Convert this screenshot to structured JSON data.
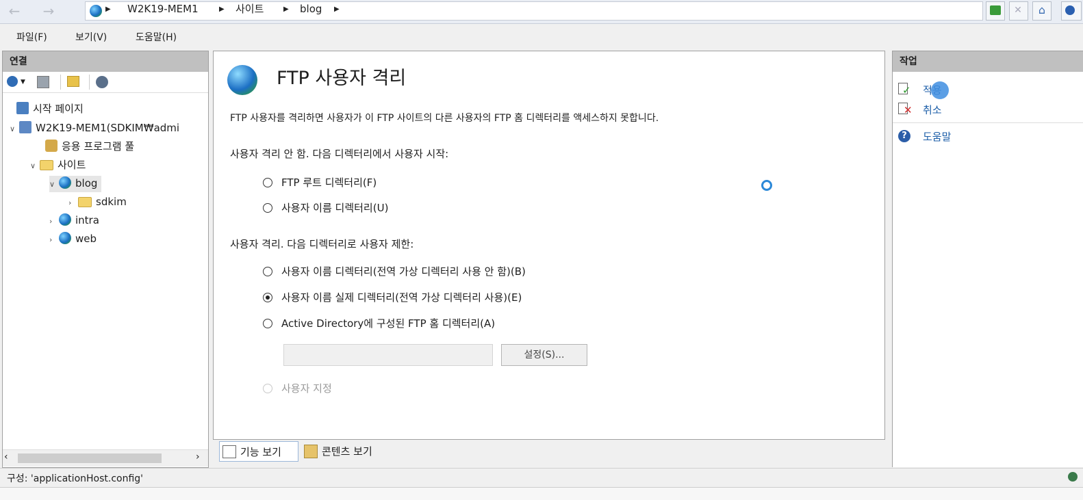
{
  "address": {
    "crumbs": [
      "W2K19-MEM1",
      "사이트",
      "blog"
    ]
  },
  "menu": [
    "파일(F)",
    "보기(V)",
    "도움말(H)"
  ],
  "left": {
    "title": "연결",
    "tree": [
      {
        "label": "시작 페이지",
        "icon": "start-page-icon"
      },
      {
        "label": "W2K19-MEM1(SDKIM₩admi",
        "icon": "server-icon"
      },
      {
        "label": "응용 프로그램 풀",
        "icon": "app-pool-icon"
      },
      {
        "label": "사이트",
        "icon": "sites-folder-icon"
      },
      {
        "label": "blog",
        "icon": "ftp-site-icon"
      },
      {
        "label": "sdkim",
        "icon": "folder-icon"
      },
      {
        "label": "intra",
        "icon": "globe-icon"
      },
      {
        "label": "web",
        "icon": "globe-icon"
      }
    ]
  },
  "center": {
    "title": "FTP 사용자 격리",
    "description": "FTP 사용자를 격리하면 사용자가 이 FTP 사이트의 다른 사용자의 FTP 홈 디렉터리를 액세스하지 못합니다.",
    "section1": "사용자 격리 안 함. 다음 디렉터리에서 사용자 시작:",
    "opt1": "FTP 루트 디렉터리(F)",
    "opt2": "사용자 이름 디렉터리(U)",
    "section2": "사용자 격리. 다음 디렉터리로 사용자 제한:",
    "opt3": "사용자 이름 디렉터리(전역 가상 디렉터리 사용 안 함)(B)",
    "opt4": "사용자 이름 실제 디렉터리(전역 가상 디렉터리 사용)(E)",
    "opt5": "Active Directory에 구성된 FTP 홈 디렉터리(A)",
    "settings_button": "설정(S)...",
    "opt6": "사용자 지정",
    "selected": "opt4"
  },
  "view_tabs": [
    "기능 보기",
    "콘텐츠 보기"
  ],
  "right": {
    "title": "작업",
    "apply": "적용",
    "cancel": "취소",
    "help": "도움말"
  },
  "status": "구성: 'applicationHost.config'"
}
